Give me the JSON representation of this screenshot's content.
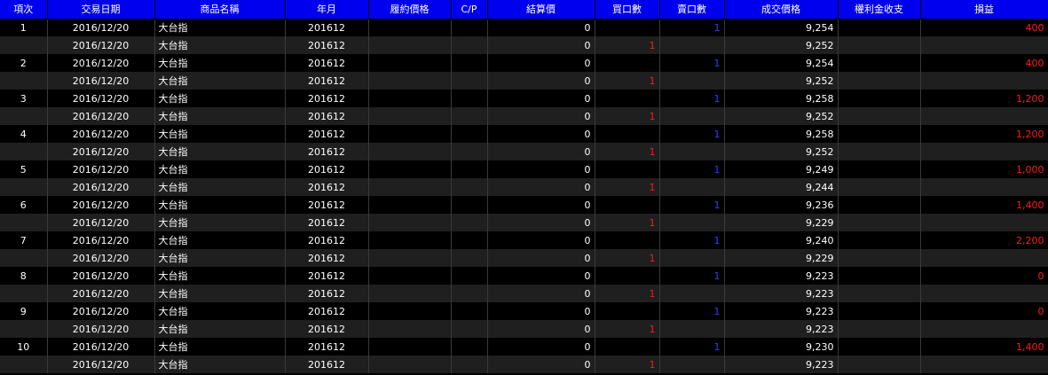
{
  "columns": [
    "項次",
    "交易日期",
    "商品名稱",
    "年月",
    "履約價格",
    "C/P",
    "結算價",
    "買口數",
    "賣口數",
    "成交價格",
    "權利金收支",
    "損益"
  ],
  "colors": {
    "header_bg": "#0000ee",
    "buy_qty": "#ff1a1a",
    "sell_qty": "#3b3bff",
    "pnl": "#ff1a1a"
  },
  "rows": [
    {
      "no": "1",
      "date": "2016/12/20",
      "product": "大台指",
      "ym": "201612",
      "strike": "",
      "cp": "",
      "settle": "0",
      "buy": "",
      "sell": "1",
      "price": "9,254",
      "premium": "",
      "pnl": "400"
    },
    {
      "no": "",
      "date": "2016/12/20",
      "product": "大台指",
      "ym": "201612",
      "strike": "",
      "cp": "",
      "settle": "0",
      "buy": "1",
      "sell": "",
      "price": "9,252",
      "premium": "",
      "pnl": ""
    },
    {
      "no": "2",
      "date": "2016/12/20",
      "product": "大台指",
      "ym": "201612",
      "strike": "",
      "cp": "",
      "settle": "0",
      "buy": "",
      "sell": "1",
      "price": "9,254",
      "premium": "",
      "pnl": "400"
    },
    {
      "no": "",
      "date": "2016/12/20",
      "product": "大台指",
      "ym": "201612",
      "strike": "",
      "cp": "",
      "settle": "0",
      "buy": "1",
      "sell": "",
      "price": "9,252",
      "premium": "",
      "pnl": ""
    },
    {
      "no": "3",
      "date": "2016/12/20",
      "product": "大台指",
      "ym": "201612",
      "strike": "",
      "cp": "",
      "settle": "0",
      "buy": "",
      "sell": "1",
      "price": "9,258",
      "premium": "",
      "pnl": "1,200"
    },
    {
      "no": "",
      "date": "2016/12/20",
      "product": "大台指",
      "ym": "201612",
      "strike": "",
      "cp": "",
      "settle": "0",
      "buy": "1",
      "sell": "",
      "price": "9,252",
      "premium": "",
      "pnl": ""
    },
    {
      "no": "4",
      "date": "2016/12/20",
      "product": "大台指",
      "ym": "201612",
      "strike": "",
      "cp": "",
      "settle": "0",
      "buy": "",
      "sell": "1",
      "price": "9,258",
      "premium": "",
      "pnl": "1,200"
    },
    {
      "no": "",
      "date": "2016/12/20",
      "product": "大台指",
      "ym": "201612",
      "strike": "",
      "cp": "",
      "settle": "0",
      "buy": "1",
      "sell": "",
      "price": "9,252",
      "premium": "",
      "pnl": ""
    },
    {
      "no": "5",
      "date": "2016/12/20",
      "product": "大台指",
      "ym": "201612",
      "strike": "",
      "cp": "",
      "settle": "0",
      "buy": "",
      "sell": "1",
      "price": "9,249",
      "premium": "",
      "pnl": "1,000"
    },
    {
      "no": "",
      "date": "2016/12/20",
      "product": "大台指",
      "ym": "201612",
      "strike": "",
      "cp": "",
      "settle": "0",
      "buy": "1",
      "sell": "",
      "price": "9,244",
      "premium": "",
      "pnl": ""
    },
    {
      "no": "6",
      "date": "2016/12/20",
      "product": "大台指",
      "ym": "201612",
      "strike": "",
      "cp": "",
      "settle": "0",
      "buy": "",
      "sell": "1",
      "price": "9,236",
      "premium": "",
      "pnl": "1,400"
    },
    {
      "no": "",
      "date": "2016/12/20",
      "product": "大台指",
      "ym": "201612",
      "strike": "",
      "cp": "",
      "settle": "0",
      "buy": "1",
      "sell": "",
      "price": "9,229",
      "premium": "",
      "pnl": ""
    },
    {
      "no": "7",
      "date": "2016/12/20",
      "product": "大台指",
      "ym": "201612",
      "strike": "",
      "cp": "",
      "settle": "0",
      "buy": "",
      "sell": "1",
      "price": "9,240",
      "premium": "",
      "pnl": "2,200"
    },
    {
      "no": "",
      "date": "2016/12/20",
      "product": "大台指",
      "ym": "201612",
      "strike": "",
      "cp": "",
      "settle": "0",
      "buy": "1",
      "sell": "",
      "price": "9,229",
      "premium": "",
      "pnl": ""
    },
    {
      "no": "8",
      "date": "2016/12/20",
      "product": "大台指",
      "ym": "201612",
      "strike": "",
      "cp": "",
      "settle": "0",
      "buy": "",
      "sell": "1",
      "price": "9,223",
      "premium": "",
      "pnl": "0"
    },
    {
      "no": "",
      "date": "2016/12/20",
      "product": "大台指",
      "ym": "201612",
      "strike": "",
      "cp": "",
      "settle": "0",
      "buy": "1",
      "sell": "",
      "price": "9,223",
      "premium": "",
      "pnl": ""
    },
    {
      "no": "9",
      "date": "2016/12/20",
      "product": "大台指",
      "ym": "201612",
      "strike": "",
      "cp": "",
      "settle": "0",
      "buy": "",
      "sell": "1",
      "price": "9,223",
      "premium": "",
      "pnl": "0"
    },
    {
      "no": "",
      "date": "2016/12/20",
      "product": "大台指",
      "ym": "201612",
      "strike": "",
      "cp": "",
      "settle": "0",
      "buy": "1",
      "sell": "",
      "price": "9,223",
      "premium": "",
      "pnl": ""
    },
    {
      "no": "10",
      "date": "2016/12/20",
      "product": "大台指",
      "ym": "201612",
      "strike": "",
      "cp": "",
      "settle": "0",
      "buy": "",
      "sell": "1",
      "price": "9,230",
      "premium": "",
      "pnl": "1,400"
    },
    {
      "no": "",
      "date": "2016/12/20",
      "product": "大台指",
      "ym": "201612",
      "strike": "",
      "cp": "",
      "settle": "0",
      "buy": "1",
      "sell": "",
      "price": "9,223",
      "premium": "",
      "pnl": ""
    }
  ]
}
